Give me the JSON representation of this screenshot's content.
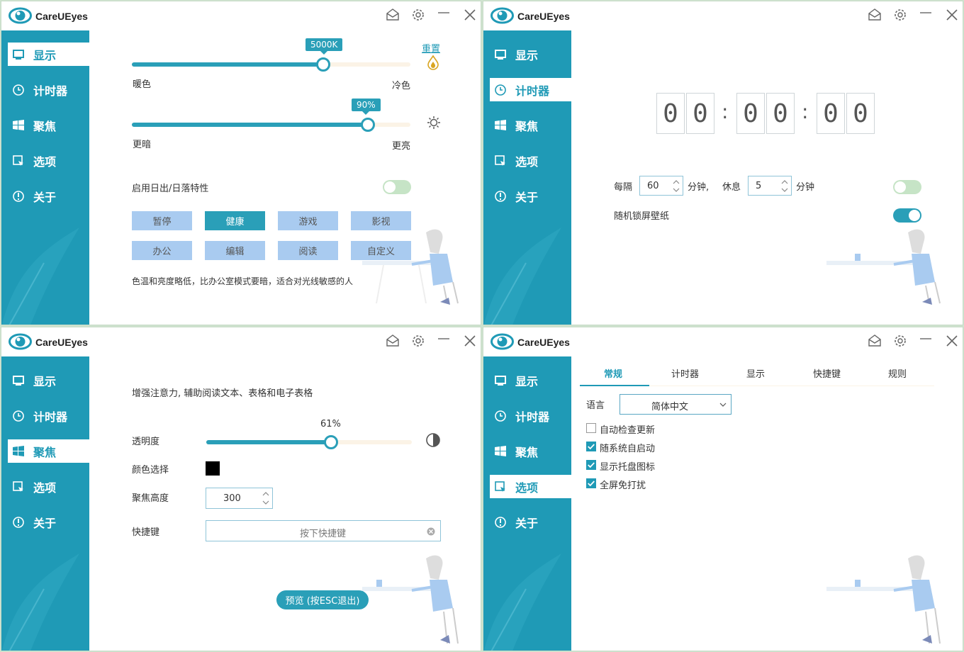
{
  "app_title": "CareUEyes",
  "nav": [
    "显示",
    "计时器",
    "聚焦",
    "选项",
    "关于"
  ],
  "display": {
    "reset_label": "重置",
    "color_temp": {
      "value_label": "5000K",
      "fraction": 0.69,
      "left_label": "暖色",
      "right_label": "冷色"
    },
    "brightness": {
      "value_label": "90%",
      "fraction": 0.84,
      "left_label": "更暗",
      "right_label": "更亮"
    },
    "sunrise_label": "启用日出/日落特性",
    "sunrise_enabled": false,
    "modes": [
      "暂停",
      "健康",
      "游戏",
      "影视",
      "办公",
      "编辑",
      "阅读",
      "自定义"
    ],
    "active_mode": "健康",
    "description": "色温和亮度略低，比办公室模式要暗，适合对光线敏感的人"
  },
  "timer": {
    "digits": [
      "0",
      "0",
      "0",
      "0",
      "0",
      "0"
    ],
    "every_label": "每隔",
    "every_value": "60",
    "minutes_comma": "分钟,",
    "rest_label": "休息",
    "rest_value": "5",
    "minutes": "分钟",
    "timer_enabled": false,
    "lock_wallpaper_label": "随机锁屏壁纸",
    "lock_wallpaper_enabled": true
  },
  "focus": {
    "description": "增强注意力, 辅助阅读文本、表格和电子表格",
    "opacity_label": "透明度",
    "opacity_value_label": "61%",
    "opacity_fraction": 0.61,
    "color_label": "颜色选择",
    "color_value": "#000000",
    "height_label": "聚焦高度",
    "height_value": "300",
    "hotkey_label": "快捷键",
    "hotkey_placeholder": "按下快捷键",
    "preview_button": "预览 (按ESC退出)"
  },
  "options": {
    "tabs": [
      "常规",
      "计时器",
      "显示",
      "快捷键",
      "规则"
    ],
    "active_tab": "常规",
    "language_label": "语言",
    "language_value": "简体中文",
    "checkboxes": [
      {
        "label": "自动检查更新",
        "checked": false
      },
      {
        "label": "随系统自启动",
        "checked": true
      },
      {
        "label": "显示托盘图标",
        "checked": true
      },
      {
        "label": "全屏免打扰",
        "checked": true
      }
    ]
  },
  "colors": {
    "accent": "#1f9ab6",
    "slider": "#2a9fb8",
    "mode_button": "#a9cbf0"
  }
}
